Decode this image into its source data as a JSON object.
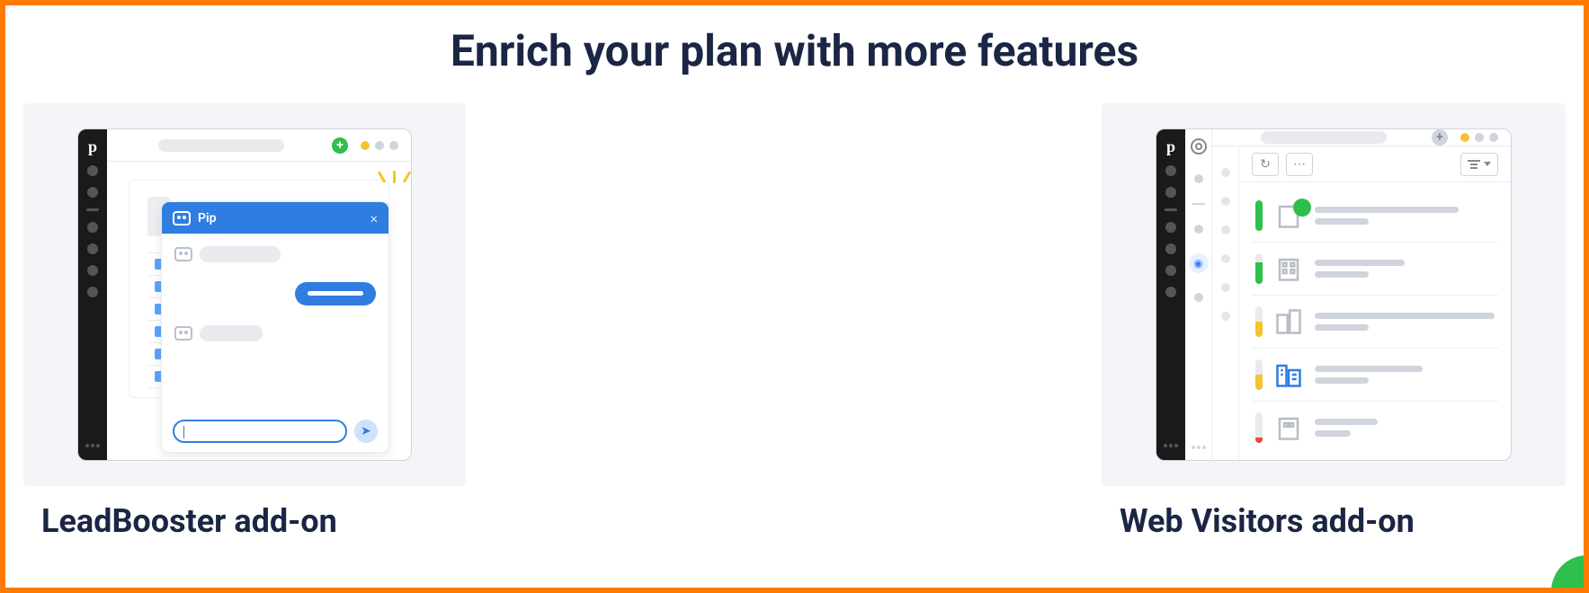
{
  "page_title": "Enrich your plan with more features",
  "cards": {
    "leadbooster": {
      "title": "LeadBooster add-on"
    },
    "webvisitors": {
      "title": "Web Visitors add-on"
    }
  },
  "chat": {
    "name": "Pip"
  },
  "app": {
    "logo": "p"
  }
}
